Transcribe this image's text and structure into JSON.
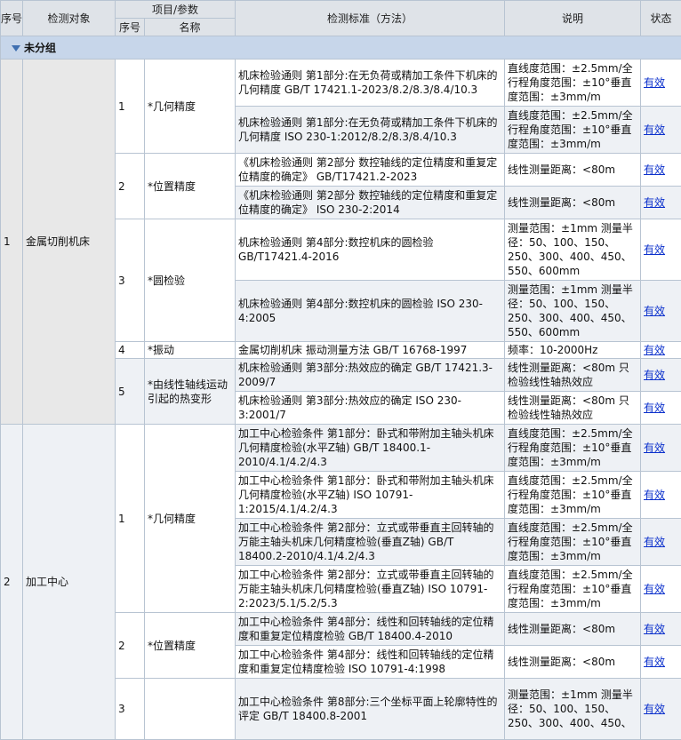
{
  "header": {
    "seq": "序号",
    "object": "检测对象",
    "item_param": "项目/参数",
    "item_seq": "序号",
    "item_name": "名称",
    "standard": "检测标准（方法）",
    "note": "说明",
    "status": "状态"
  },
  "group": {
    "label": "未分组"
  },
  "objects": [
    {
      "seq": "1",
      "name": "金属切削机床"
    },
    {
      "seq": "2",
      "name": "加工中心"
    }
  ],
  "items": [
    {
      "seq": "1",
      "name": "*几何精度"
    },
    {
      "seq": "2",
      "name": "*位置精度"
    },
    {
      "seq": "3",
      "name": "*圆检验"
    },
    {
      "seq": "4",
      "name": "*振动"
    },
    {
      "seq": "5",
      "name": "*由线性轴线运动引起的热变形"
    },
    {
      "seq": "1",
      "name": "*几何精度"
    },
    {
      "seq": "2",
      "name": "*位置精度"
    },
    {
      "seq": "3",
      "name": ""
    }
  ],
  "rows": [
    {
      "standard": "机床检验通则 第1部分:在无负荷或精加工条件下机床的几何精度 GB/T 17421.1-2023/8.2/8.3/8.4/10.3",
      "note": "直线度范围：±2.5mm/全行程角度范围：±10°垂直度范围：±3mm/m",
      "status": "有效"
    },
    {
      "standard": "机床检验通则 第1部分:在无负荷或精加工条件下机床的几何精度 ISO 230-1:2012/8.2/8.3/8.4/10.3",
      "note": "直线度范围：±2.5mm/全行程角度范围：±10°垂直度范围：±3mm/m",
      "status": "有效"
    },
    {
      "standard": "《机床检验通则 第2部分 数控轴线的定位精度和重复定位精度的确定》 GB/T17421.2-2023",
      "note": "线性测量距离：<80m",
      "status": "有效"
    },
    {
      "standard": "《机床检验通则 第2部分 数控轴线的定位精度和重复定位精度的确定》 ISO 230-2:2014",
      "note": "线性测量距离：<80m",
      "status": "有效"
    },
    {
      "standard": "机床检验通则 第4部分:数控机床的圆检验 GB/T17421.4-2016",
      "note": "测量范围：±1mm 测量半径：50、100、150、250、300、400、450、550、600mm",
      "status": "有效"
    },
    {
      "standard": "机床检验通则 第4部分:数控机床的圆检验 ISO 230-4:2005",
      "note": "测量范围：±1mm 测量半径：50、100、150、250、300、400、450、550、600mm",
      "status": "有效"
    },
    {
      "standard": "金属切削机床 振动测量方法 GB/T 16768-1997",
      "note": "频率：10-2000Hz",
      "status": "有效"
    },
    {
      "standard": "机床检验通则 第3部分:热效应的确定 GB/T 17421.3-2009/7",
      "note": "线性测量距离：<80m 只检验线性轴热效应",
      "status": "有效"
    },
    {
      "standard": "机床检验通则 第3部分:热效应的确定 ISO 230-3:2001/7",
      "note": "线性测量距离：<80m 只检验线性轴热效应",
      "status": "有效"
    },
    {
      "standard": "加工中心检验条件 第1部分：卧式和带附加主轴头机床几何精度检验(水平Z轴) GB/T 18400.1-2010/4.1/4.2/4.3",
      "note": "直线度范围：±2.5mm/全行程角度范围：±10°垂直度范围：±3mm/m",
      "status": "有效"
    },
    {
      "standard": "加工中心检验条件 第1部分：卧式和带附加主轴头机床几何精度检验(水平Z轴) ISO 10791-1:2015/4.1/4.2/4.3",
      "note": "直线度范围：±2.5mm/全行程角度范围：±10°垂直度范围：±3mm/m",
      "status": "有效"
    },
    {
      "standard": "加工中心检验条件 第2部分：立式或带垂直主回转轴的万能主轴头机床几何精度检验(垂直Z轴) GB/T 18400.2-2010/4.1/4.2/4.3",
      "note": "直线度范围：±2.5mm/全行程角度范围：±10°垂直度范围：±3mm/m",
      "status": "有效"
    },
    {
      "standard": "加工中心检验条件 第2部分：立式或带垂直主回转轴的万能主轴头机床几何精度检验(垂直Z轴) ISO 10791-2:2023/5.1/5.2/5.3",
      "note": "直线度范围：±2.5mm/全行程角度范围：±10°垂直度范围：±3mm/m",
      "status": "有效"
    },
    {
      "standard": "加工中心检验条件 第4部分：线性和回转轴线的定位精度和重复定位精度检验 GB/T 18400.4-2010",
      "note": "线性测量距离：<80m",
      "status": "有效"
    },
    {
      "standard": "加工中心检验条件 第4部分：线性和回转轴线的定位精度和重复定位精度检验 ISO 10791-4:1998",
      "note": "线性测量距离：<80m",
      "status": "有效"
    },
    {
      "standard": "加工中心检验条件 第8部分:三个坐标平面上轮廓特性的评定 GB/T 18400.8-2001",
      "note": "测量范围：±1mm 测量半径：50、100、150、250、300、400、450、",
      "status": "有效"
    }
  ]
}
